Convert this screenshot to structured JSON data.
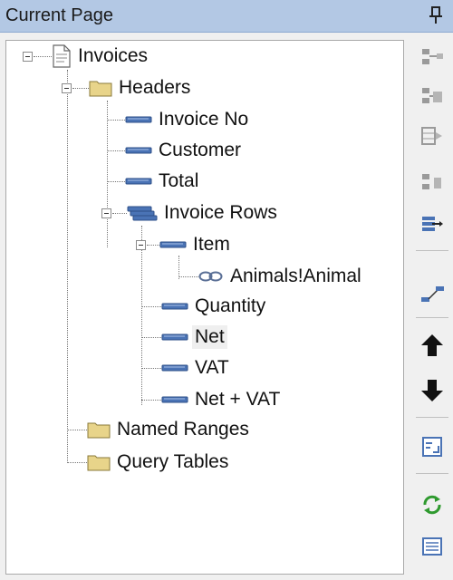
{
  "panel": {
    "title": "Current Page"
  },
  "tree": {
    "root": "Invoices",
    "headers": "Headers",
    "invoice_no": "Invoice No",
    "customer": "Customer",
    "total": "Total",
    "invoice_rows": "Invoice Rows",
    "item": "Item",
    "item_link": "Animals!Animal",
    "quantity": "Quantity",
    "net": "Net",
    "vat": "VAT",
    "net_vat": "Net + VAT",
    "named_ranges": "Named Ranges",
    "query_tables": "Query Tables"
  },
  "icons": {
    "pin": "pin-icon",
    "document": "document-icon",
    "folder": "folder-icon",
    "field": "field-icon",
    "repeating_group": "repeating-group-icon",
    "link": "link-icon",
    "toolbar": [
      "add-field-icon",
      "add-group-icon",
      "add-table-icon",
      "add-row-field-icon",
      "insert-after-icon",
      "link-range-icon",
      "move-up-icon",
      "move-down-icon",
      "properties-icon",
      "refresh-icon",
      "list-view-icon"
    ]
  },
  "colors": {
    "title_bar": "#b3c8e4",
    "folder": "#e8d48a",
    "field": "#4a73b5",
    "refresh": "#2f9a2f"
  }
}
